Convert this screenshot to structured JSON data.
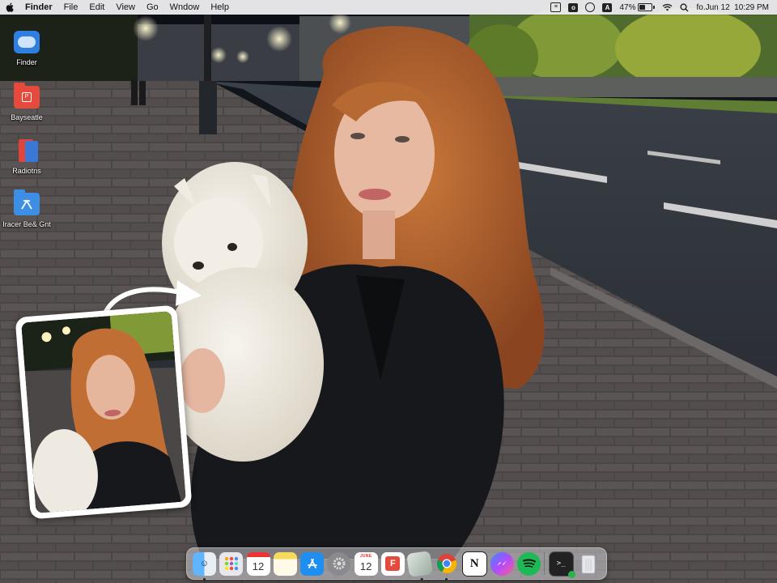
{
  "menubar": {
    "app_name": "Finder",
    "menus": [
      "File",
      "Edit",
      "View",
      "Go",
      "Wndow",
      "Help"
    ],
    "battery_percent": "47%",
    "battery_level": 0.47,
    "clock": "fo.Jun 12  10:29 PM",
    "status_icons": [
      "screen-mirroring-icon",
      "dark-app-icon",
      "record-icon",
      "input-source-icon",
      "battery-icon",
      "wifi-icon",
      "search-icon"
    ]
  },
  "desktop": {
    "icons": [
      {
        "label": "Finder",
        "icon": "finder-drive-icon",
        "color": "#2f7fe0"
      },
      {
        "label": "Bayseatle",
        "icon": "red-folder-icon",
        "color": "#e64a3c"
      },
      {
        "label": "Radiotns",
        "icon": "stacked-files-icon",
        "color": "#e0443a"
      },
      {
        "label": "Iracer Be& Gnt",
        "icon": "blue-folder-icon",
        "color": "#3d8fe6"
      }
    ]
  },
  "dock": {
    "calendar_day": "12",
    "calendar_month": "JUNE",
    "apps": [
      "finder-icon",
      "launchpad-icon",
      "calendar-icon",
      "notes-icon",
      "app-store-icon",
      "system-settings-icon",
      "calendar-icon",
      "flashcard-app-icon",
      "preview-icon",
      "chrome-icon",
      "notion-icon",
      "messenger-icon",
      "spotify-icon",
      "terminal-icon",
      "trash-icon"
    ]
  }
}
